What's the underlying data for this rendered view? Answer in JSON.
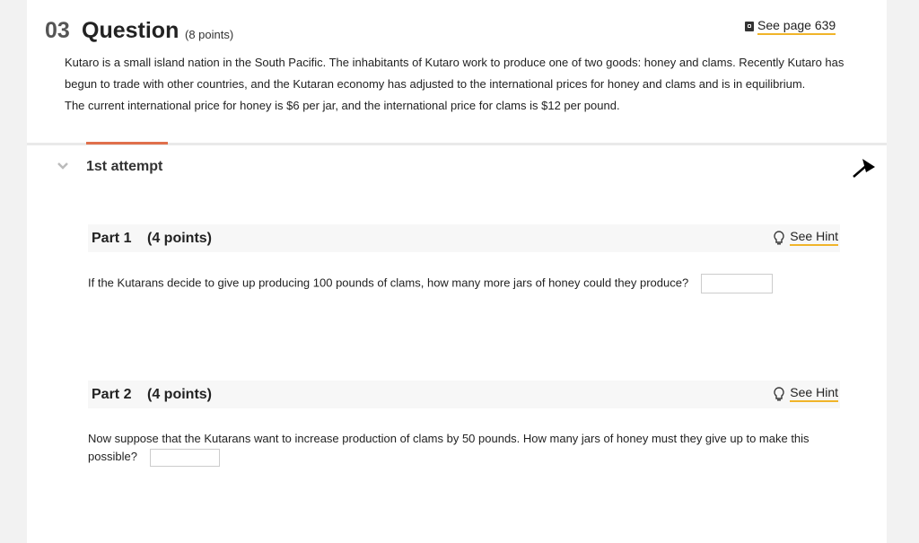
{
  "question": {
    "number": "03",
    "word": "Question",
    "points": "(8 points)",
    "see_page": "See page 639",
    "text_lines": [
      "Kutaro is a small island nation in the South Pacific. The inhabitants of Kutaro work to produce one of two goods: honey and clams. Recently Kutaro has begun to trade with other countries, and the Kutaran economy has adjusted to the international prices for honey and clams and is in equilibrium.",
      "The current international price for honey is $6 per jar, and the international price for clams is $12 per pound."
    ]
  },
  "attempt": {
    "label": "1st attempt"
  },
  "parts": [
    {
      "title": "Part 1",
      "points": "(4 points)",
      "hint": "See Hint",
      "question": "If the Kutarans decide to give up producing 100 pounds of clams, how many more jars of honey could they produce?",
      "answer": ""
    },
    {
      "title": "Part 2",
      "points": "(4 points)",
      "hint": "See Hint",
      "question": "Now suppose that the Kutarans want to increase production of clams by 50 pounds. How many jars of honey must they give up to make this possible?",
      "answer": ""
    }
  ],
  "colors": {
    "accent_underline": "#f0b429",
    "tab_accent": "#e0704c",
    "background": "#f2f2f2"
  }
}
